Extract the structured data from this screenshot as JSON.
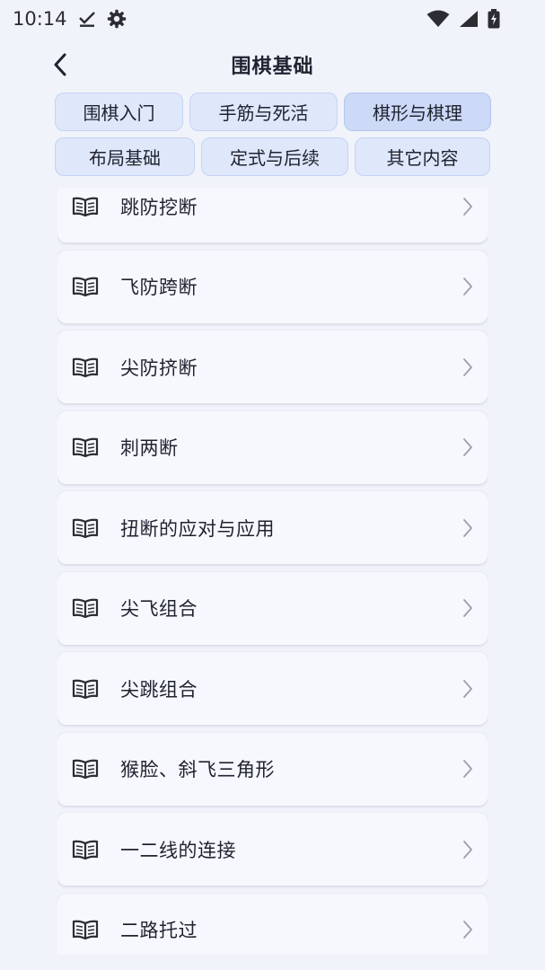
{
  "status_bar": {
    "time": "10:14"
  },
  "header": {
    "title": "围棋基础"
  },
  "tabs": [
    [
      {
        "label": "围棋入门",
        "active": false
      },
      {
        "label": "手筋与死活",
        "active": false
      },
      {
        "label": "棋形与棋理",
        "active": true
      }
    ],
    [
      {
        "label": "布局基础",
        "active": false
      },
      {
        "label": "定式与后续",
        "active": false
      },
      {
        "label": "其它内容",
        "active": false
      }
    ]
  ],
  "lessons": [
    {
      "label": "跳防挖断"
    },
    {
      "label": "飞防跨断"
    },
    {
      "label": "尖防挤断"
    },
    {
      "label": "刺两断"
    },
    {
      "label": "扭断的应对与应用"
    },
    {
      "label": "尖飞组合"
    },
    {
      "label": "尖跳组合"
    },
    {
      "label": "猴脸、斜飞三角形"
    },
    {
      "label": "一二线的连接"
    },
    {
      "label": "二路托过"
    }
  ],
  "icons": {
    "lesson": "open-book-icon",
    "row_arrow": "chevron-right-icon",
    "back": "back-arrow-icon"
  },
  "colors": {
    "background": "#f1f3fb",
    "tab_fill": "#dfe7fb",
    "tab_active_fill": "#ccd9f7",
    "card_fill": "#f7f8fd"
  }
}
